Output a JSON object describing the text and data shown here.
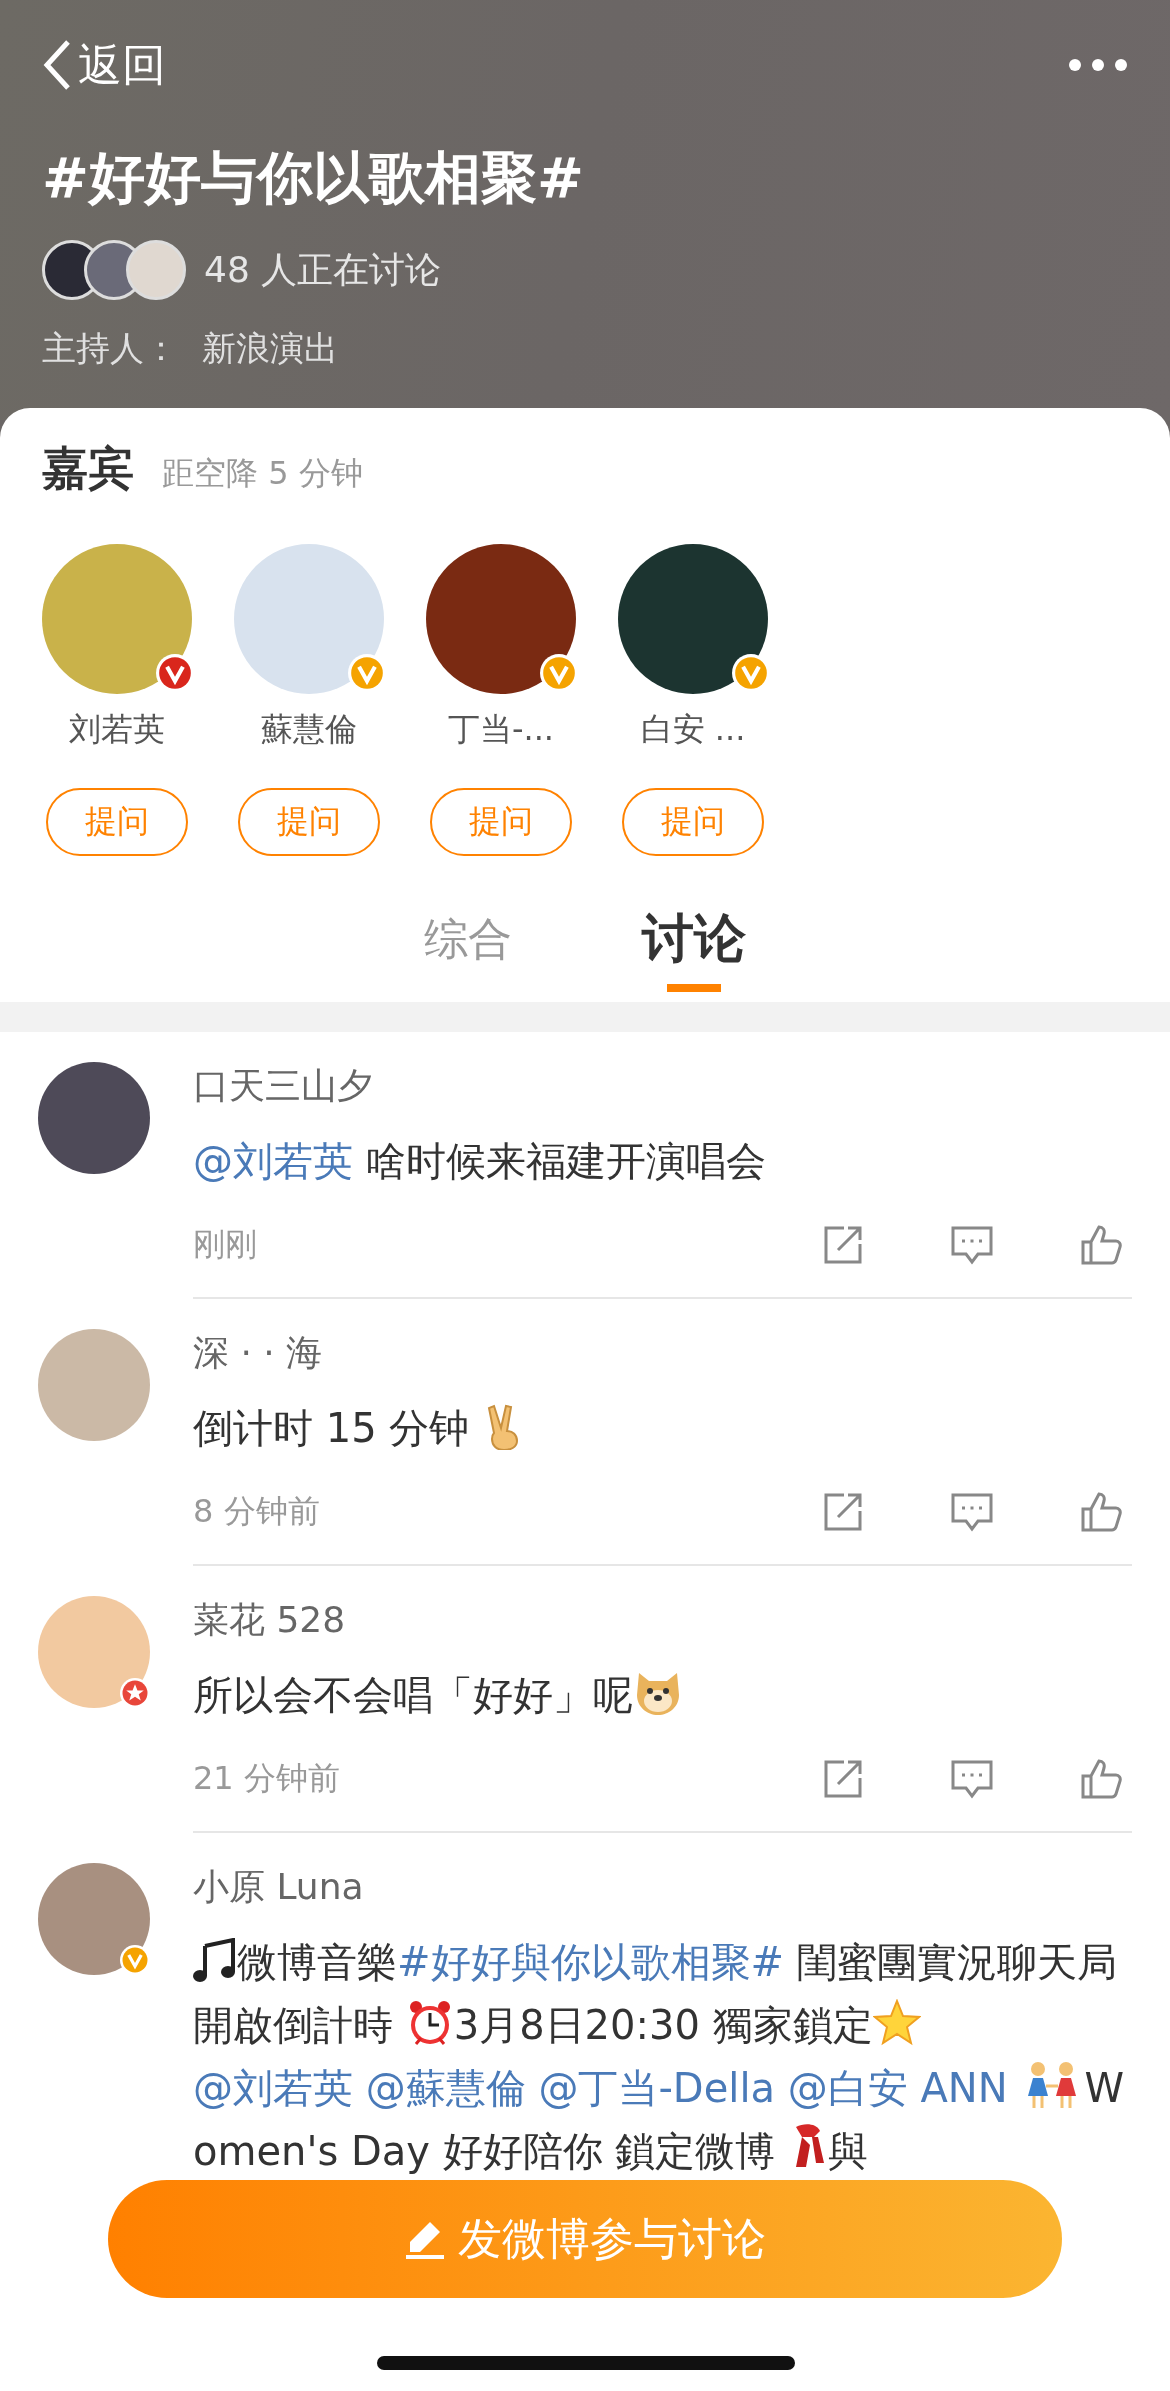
{
  "header": {
    "back_label": "返回",
    "title": "#好好与你以歌相聚#",
    "discussing": "48 人正在讨论",
    "host_label": "主持人：",
    "host_name": "新浪演出"
  },
  "guests": {
    "title": "嘉宾",
    "countdown": "距空降 5 分钟",
    "items": [
      {
        "name": "刘若英",
        "badge": {
          "kind": "v",
          "color": "#d9261c"
        },
        "button": "提问"
      },
      {
        "name": "蘇慧倫",
        "badge": {
          "kind": "v",
          "color": "#f5a300"
        },
        "button": "提问"
      },
      {
        "name": "丁当-...",
        "badge": {
          "kind": "v",
          "color": "#f5a300"
        },
        "button": "提问"
      },
      {
        "name": "白安 ...",
        "badge": {
          "kind": "v",
          "color": "#f5a300"
        },
        "button": "提问"
      }
    ]
  },
  "tabs": [
    {
      "label": "综合",
      "selected": false
    },
    {
      "label": "讨论",
      "selected": true
    }
  ],
  "comments": [
    {
      "author": "口天三山夕",
      "body": [
        {
          "kind": "link",
          "text": "@刘若英"
        },
        {
          "kind": "text",
          "text": " 啥时候来福建开演唱会"
        }
      ],
      "time": "刚刚"
    },
    {
      "author": "深 · · 海",
      "body": [
        {
          "kind": "text",
          "text": "倒计时 15 分钟 "
        },
        {
          "kind": "emoji"
        }
      ],
      "time": "8 分钟前"
    },
    {
      "author": "菜花 528",
      "badge": {
        "kind": "star",
        "color": "#e8463a"
      },
      "body": [
        {
          "kind": "text",
          "text": "所以会不会唱「好好」呢"
        },
        {
          "kind": "emoji"
        }
      ],
      "time": "21 分钟前"
    },
    {
      "author": "小原 Luna",
      "badge": {
        "kind": "v",
        "color": "#f5a300"
      },
      "body": [
        {
          "kind": "emoji"
        },
        {
          "kind": "text",
          "text": "微博音樂"
        },
        {
          "kind": "link",
          "text": "#好好與你以歌相聚#"
        },
        {
          "kind": "text",
          "text": " 閨蜜團實況聊天局開啟倒計時 "
        },
        {
          "kind": "emoji"
        },
        {
          "kind": "text",
          "text": "3月8日20:30 獨家鎖定"
        },
        {
          "kind": "emoji"
        },
        {
          "kind": "link",
          "text": "@刘若英 "
        },
        {
          "kind": "link",
          "text": "@蘇慧倫 "
        },
        {
          "kind": "link",
          "text": "@丁当-Della "
        },
        {
          "kind": "link",
          "text": "@白安 ANN "
        },
        {
          "kind": "emoji"
        },
        {
          "kind": "text",
          "text": "Women's Day 好好陪你 鎖定微博 "
        },
        {
          "kind": "emoji"
        },
        {
          "kind": "text",
          "text": "與"
        }
      ]
    }
  ],
  "post_button": "发微博参与讨论"
}
